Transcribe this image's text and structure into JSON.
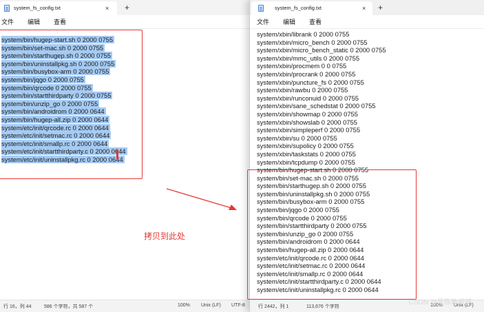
{
  "left_window": {
    "tab_title": "system_fs_config.txt",
    "tab_close": "×",
    "new_tab": "+",
    "menu": [
      "文件",
      "编辑",
      "查看"
    ],
    "lines": [
      "system/bin/hugep-start.sh 0 2000 0755",
      "system/bin/set-mac.sh 0 2000 0755",
      "system/bin/starthugep.sh 0 2000 0755",
      "system/bin/uninstallpkg.sh 0 2000 0755",
      "system/bin/busybox-arm 0 2000 0755",
      "system/bin/jqgo 0 2000 0755",
      "system/bin/qrcode 0 2000 0755",
      "system/bin/startthirdparty 0 2000 0755",
      "system/bin/unzip_go 0 2000 0755",
      "system/bin/androidrom 0 2000 0644",
      "system/bin/hugep-all.zip 0 2000 0644",
      "system/etc/init/qrcode.rc 0 2000 0644",
      "system/etc/init/setmac.rc 0 2000 0644",
      "system/etc/init/smallp.rc 0 2000 0644",
      "system/etc/init/startthirdparty.c 0 2000 0644",
      "system/etc/init/uninstallpkg.rc 0 2000 0644"
    ],
    "status": {
      "position": "行 16，列 44",
      "chars": "586 个字符，共 587 个",
      "zoom": "100%",
      "eol": "Unix (LF)",
      "encoding": "UTF-8"
    }
  },
  "right_window": {
    "tab_title": "system_fs_config.txt",
    "tab_close": "×",
    "new_tab": "+",
    "menu": [
      "文件",
      "编辑",
      "查看"
    ],
    "lines": [
      "system/xbin/librank 0 2000 0755",
      "system/xbin/micro_bench 0 2000 0755",
      "system/xbin/micro_bench_static 0 2000 0755",
      "system/xbin/mmc_utils 0 2000 0755",
      "system/xbin/procmem 0 0 0755",
      "system/xbin/procrank 0 2000 0755",
      "system/xbin/puncture_fs 0 2000 0755",
      "system/xbin/rawbu 0 2000 0755",
      "system/xbin/runconuid 0 2000 0755",
      "system/xbin/sane_schedstat 0 2000 0755",
      "system/xbin/showmap 0 2000 0755",
      "system/xbin/showslab 0 2000 0755",
      "system/xbin/simpleperf 0 2000 0755",
      "system/xbin/su 0 2000 0755",
      "system/xbin/supolicy 0 2000 0755",
      "system/xbin/taskstats 0 2000 0755",
      "system/xbin/tcpdump 0 2000 0755",
      "system/bin/hugep-start.sh 0 2000 0755",
      "system/bin/set-mac.sh 0 2000 0755",
      "system/bin/starthugep.sh 0 2000 0755",
      "system/bin/uninstallpkg.sh 0 2000 0755",
      "system/bin/busybox-arm 0 2000 0755",
      "system/bin/jqgo 0 2000 0755",
      "system/bin/qrcode 0 2000 0755",
      "system/bin/startthirdparty 0 2000 0755",
      "system/bin/unzip_go 0 2000 0755",
      "system/bin/androidrom 0 2000 0644",
      "system/bin/hugep-all.zip 0 2000 0644",
      "system/etc/init/qrcode.rc 0 2000 0644",
      "system/etc/init/setmac.rc 0 2000 0644",
      "system/etc/init/smallp.rc 0 2000 0644",
      "system/etc/init/startthirdparty.c 0 2000 0644",
      "system/etc/init/uninstallpkg.rc 0 2000 0644"
    ],
    "status": {
      "position": "行 2442，列 1",
      "chars": "113,676 个字符",
      "zoom": "100%",
      "eol": "Unix (LF)"
    }
  },
  "annotation": {
    "caption": "拷贝到此处",
    "color": "#e53935"
  },
  "watermark": "CSDN @是陈教授呀",
  "colors": {
    "selection": "#a6cbf3",
    "annotation_red": "#e53935",
    "tab_bar": "#f3f3f3"
  }
}
